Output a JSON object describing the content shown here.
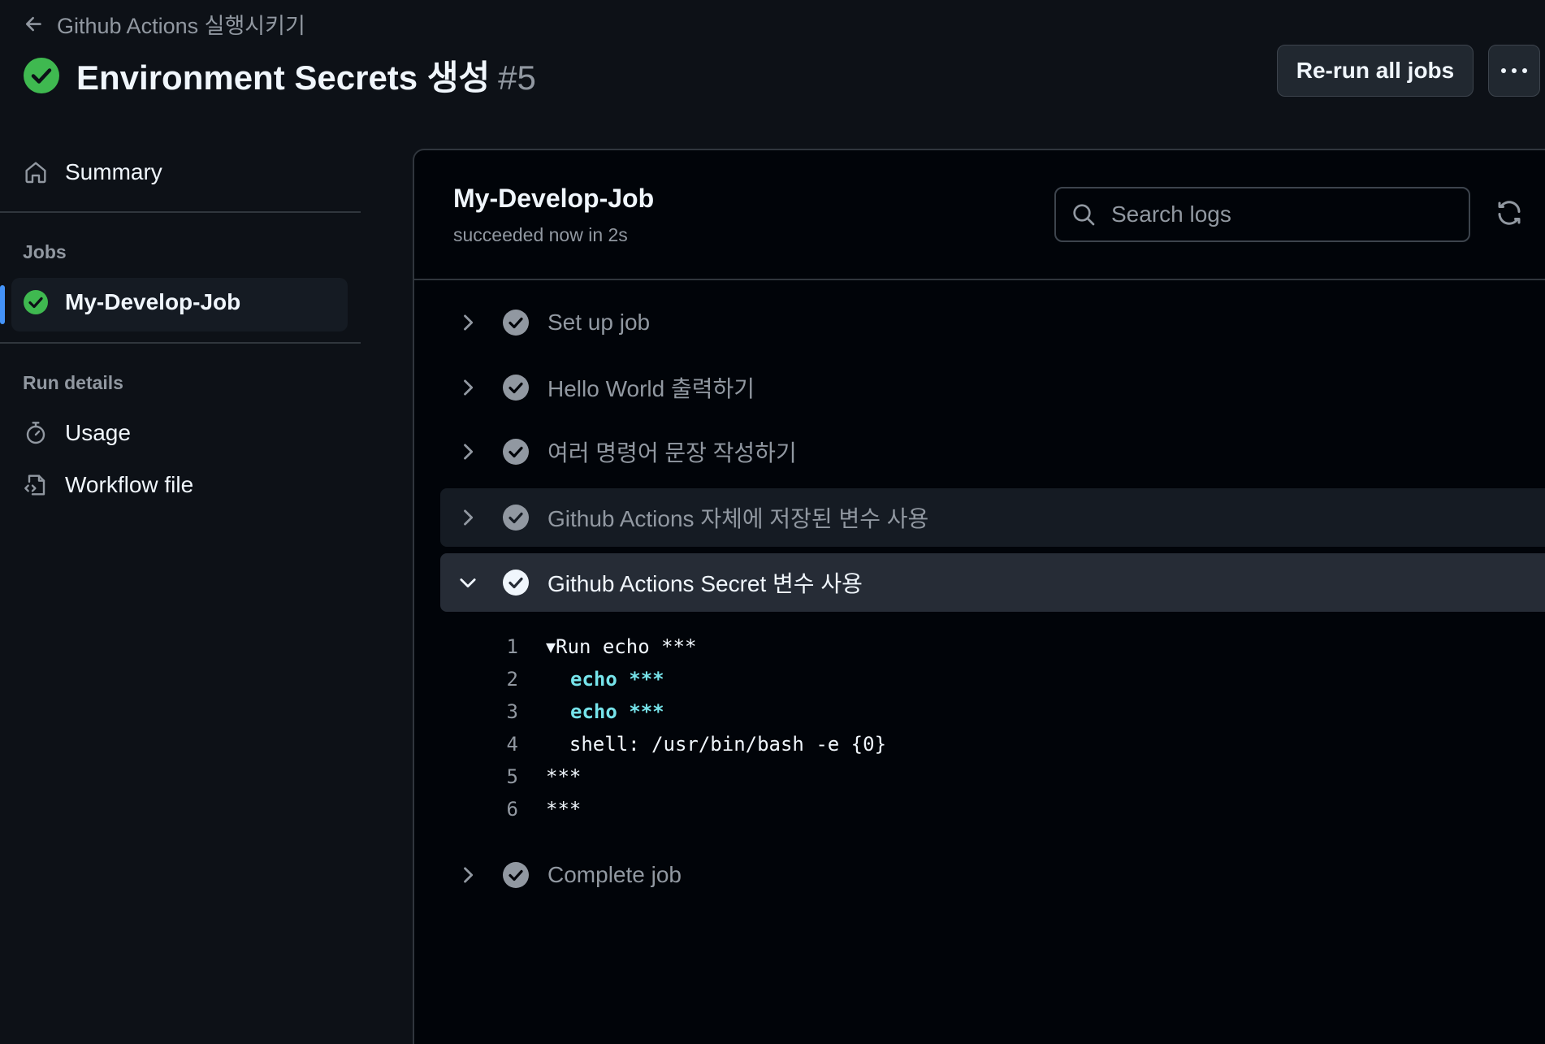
{
  "header": {
    "back_label": "Github Actions 실행시키기",
    "title": "Environment Secrets 생성",
    "run_number": "#5",
    "rerun_label": "Re-run all jobs",
    "more_label": "···"
  },
  "sidebar": {
    "summary_label": "Summary",
    "jobs_heading": "Jobs",
    "active_job": "My-Develop-Job",
    "run_details_heading": "Run details",
    "usage_label": "Usage",
    "workflow_file_label": "Workflow file"
  },
  "job": {
    "title": "My-Develop-Job",
    "status": "succeeded now in 2s",
    "search_placeholder": "Search logs"
  },
  "steps": [
    {
      "label": "Set up job"
    },
    {
      "label": "Hello World 출력하기"
    },
    {
      "label": "여러 명령어 문장 작성하기"
    },
    {
      "label": "Github Actions 자체에 저장된 변수 사용"
    },
    {
      "label": "Github Actions Secret 변수 사용"
    },
    {
      "label": "Complete job"
    }
  ],
  "log_lines": [
    {
      "num": "1",
      "prefix": "▼",
      "text": "Run echo ***"
    },
    {
      "num": "2",
      "keyword": "echo",
      "text": " ***"
    },
    {
      "num": "3",
      "keyword": "echo",
      "text": " ***"
    },
    {
      "num": "4",
      "text": "  shell: /usr/bin/bash -e {0}"
    },
    {
      "num": "5",
      "text": "***"
    },
    {
      "num": "6",
      "text": "***"
    }
  ],
  "colors": {
    "background": "#0d1117",
    "success_green": "#3fb950",
    "accent_blue": "#4493f8",
    "log_keyword_cyan": "#76e3ea"
  }
}
